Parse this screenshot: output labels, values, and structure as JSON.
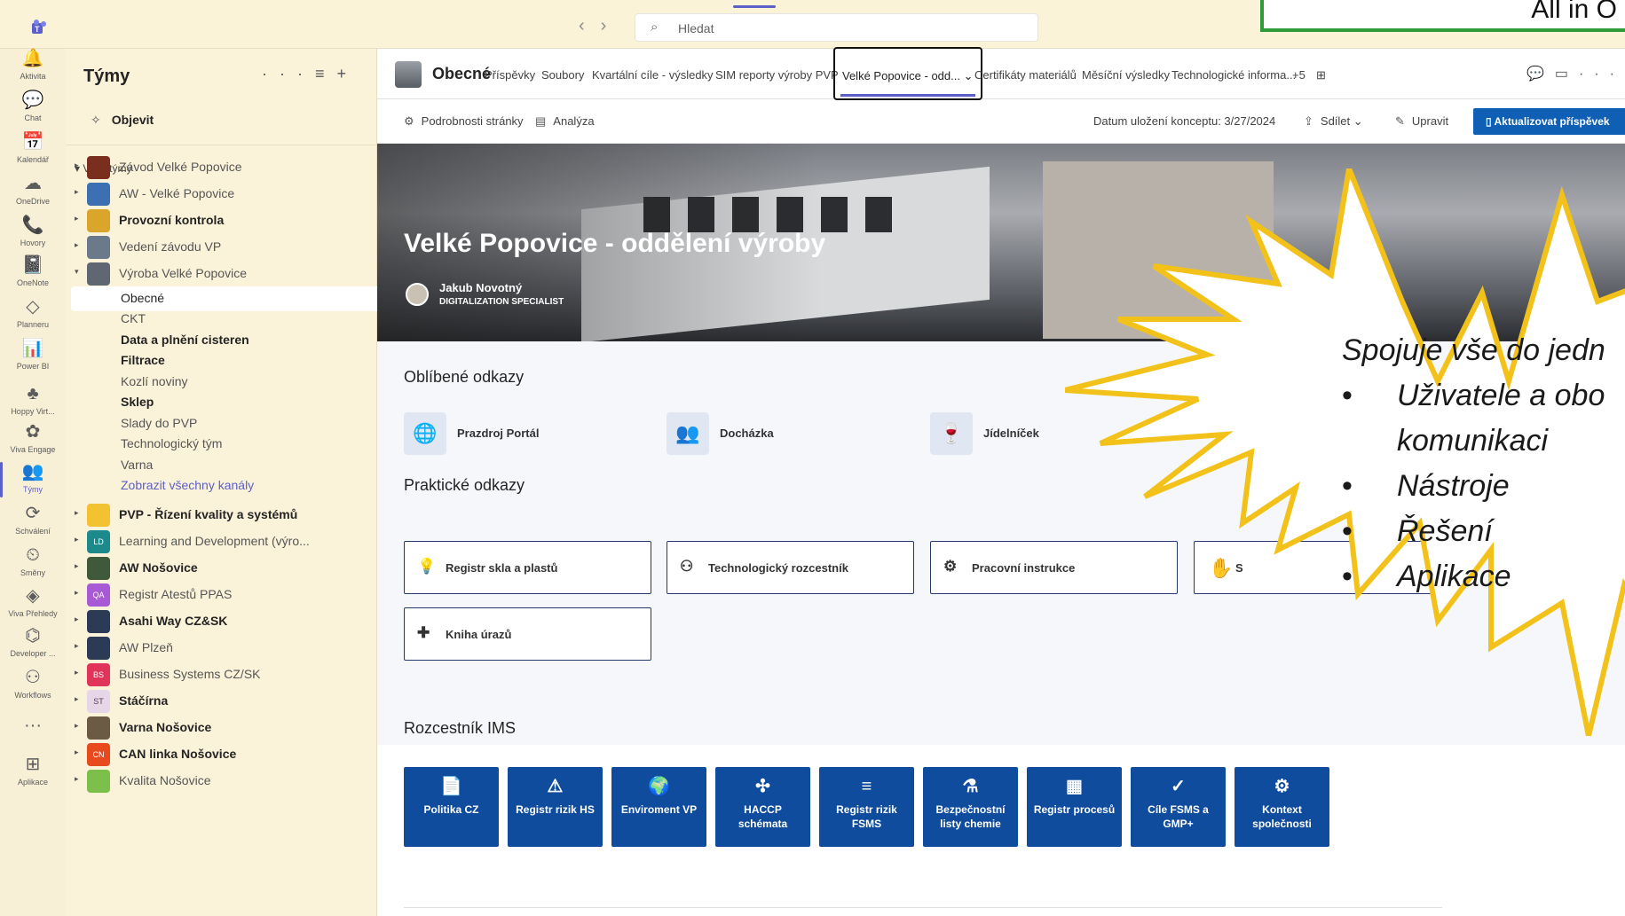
{
  "top": {
    "search_placeholder": "Hledat",
    "overlay_text": "All in O"
  },
  "rail": [
    {
      "icon": "bell-icon",
      "glyph": "🔔",
      "label": "Aktivita"
    },
    {
      "icon": "chat-icon",
      "glyph": "💬",
      "label": "Chat"
    },
    {
      "icon": "calendar-icon",
      "glyph": "📅",
      "label": "Kalendář"
    },
    {
      "icon": "cloud-icon",
      "glyph": "☁",
      "label": "OneDrive"
    },
    {
      "icon": "phone-icon",
      "glyph": "📞",
      "label": "Hovory"
    },
    {
      "icon": "onenote-icon",
      "glyph": "📓",
      "label": "OneNote"
    },
    {
      "icon": "planner-icon",
      "glyph": "◇",
      "label": "Planneru"
    },
    {
      "icon": "powerbi-icon",
      "glyph": "📊",
      "label": "Power BI"
    },
    {
      "icon": "hoppy-icon",
      "glyph": "♣",
      "label": "Hoppy Virt..."
    },
    {
      "icon": "viva-engage-icon",
      "glyph": "✿",
      "label": "Viva Engage"
    },
    {
      "icon": "teams-icon",
      "glyph": "👥",
      "label": "Týmy"
    },
    {
      "icon": "approvals-icon",
      "glyph": "⟳",
      "label": "Schválení"
    },
    {
      "icon": "shifts-icon",
      "glyph": "⏲",
      "label": "Směny"
    },
    {
      "icon": "viva-insights-icon",
      "glyph": "◈",
      "label": "Viva Přehledy"
    },
    {
      "icon": "developer-icon",
      "glyph": "⌬",
      "label": "Developer ..."
    },
    {
      "icon": "workflows-icon",
      "glyph": "⚇",
      "label": "Workflows"
    },
    {
      "icon": "more-icon",
      "glyph": "···",
      "label": ""
    },
    {
      "icon": "apps-icon",
      "glyph": "⊞",
      "label": "Aplikace"
    }
  ],
  "teamlist": {
    "title": "Týmy",
    "discover": "Objevit",
    "your_teams": "Vaše týmy",
    "teams_top": [
      {
        "name": "Závod Velké Popovice",
        "color": "#7a2e1e",
        "abbr": "",
        "bold": false
      },
      {
        "name": "AW - Velké Popovice",
        "color": "#3d6fb3",
        "abbr": "",
        "bold": false
      },
      {
        "name": "Provozní kontrola",
        "color": "#d9a52a",
        "abbr": "",
        "bold": true
      },
      {
        "name": "Vedení závodu VP",
        "color": "#6b7a8a",
        "abbr": "",
        "bold": false
      },
      {
        "name": "Výroba Velké Popovice",
        "color": "#5f6872",
        "abbr": "",
        "bold": false
      }
    ],
    "channels": [
      {
        "name": "Obecné",
        "style": "sel"
      },
      {
        "name": "CKT",
        "style": "dim"
      },
      {
        "name": "Data a plnění cisteren",
        "style": "bold"
      },
      {
        "name": "Filtrace",
        "style": "bold"
      },
      {
        "name": "Kozlí noviny",
        "style": "dim"
      },
      {
        "name": "Sklep",
        "style": "bold"
      },
      {
        "name": "Slady do PVP",
        "style": "dim"
      },
      {
        "name": "Technologický tým",
        "style": "dim"
      },
      {
        "name": "Varna",
        "style": "dim"
      },
      {
        "name": "Zobrazit všechny kanály",
        "style": "link"
      }
    ],
    "teams_bottom": [
      {
        "name": "PVP - Řízení kvality a systémů",
        "color": "#f2c230",
        "abbr": "",
        "bold": true
      },
      {
        "name": "Learning and Development (výro...",
        "color": "#1c8a8a",
        "abbr": "LD",
        "bold": false
      },
      {
        "name": "AW Nošovice",
        "color": "#3f5a3a",
        "abbr": "",
        "bold": true
      },
      {
        "name": "Registr Atestů PPAS",
        "color": "#a85ad6",
        "abbr": "QA",
        "bold": false
      },
      {
        "name": "Asahi Way CZ&SK",
        "color": "#2b3a55",
        "abbr": "",
        "bold": true
      },
      {
        "name": "AW Plzeň",
        "color": "#2b3a55",
        "abbr": "",
        "bold": false
      },
      {
        "name": "Business Systems CZ/SK",
        "color": "#e0345a",
        "abbr": "BS",
        "bold": false
      },
      {
        "name": "Stáčírna",
        "color": "#e7d6e8",
        "abbr": "ST",
        "bold": true
      },
      {
        "name": "Varna Nošovice",
        "color": "#6b5a44",
        "abbr": "",
        "bold": true
      },
      {
        "name": "CAN linka Nošovice",
        "color": "#e84a1e",
        "abbr": "CN",
        "bold": true
      },
      {
        "name": "Kvalita Nošovice",
        "color": "#7cbf4a",
        "abbr": "",
        "bold": false
      }
    ]
  },
  "tabbar": {
    "channel": "Obecné",
    "tabs": [
      "Příspěvky",
      "Soubory",
      "Kvartální cíle - výsledky",
      "SIM reporty výroby PVP",
      "Velké Popovice - odd...",
      "Certifikáty materiálů",
      "Měsíční výsledky",
      "Technologické informa...",
      "+5"
    ]
  },
  "cmdbar": {
    "details": "Podrobnosti stránky",
    "analytics": "Analýza",
    "draft_saved": "Datum uložení konceptu: 3/27/2024",
    "share": "Sdílet",
    "edit": "Upravit",
    "update": "Aktualizovat příspěvek"
  },
  "hero": {
    "title": "Velké Popovice - oddělení výroby",
    "author": "Jakub Novotný",
    "role": "DIGITALIZATION SPECIALIST"
  },
  "favorites": {
    "title": "Oblíbené odkazy",
    "items": [
      {
        "label": "Prazdroj Portál",
        "glyph": "🌐",
        "icon": "globe-icon"
      },
      {
        "label": "Docházka",
        "glyph": "👥",
        "icon": "people-icon"
      },
      {
        "label": "Jídelníček",
        "glyph": "🍷",
        "icon": "glass-icon"
      }
    ]
  },
  "practical": {
    "title": "Praktické odkazy",
    "items": [
      {
        "label": "Registr skla a plastů",
        "glyph": "💡",
        "icon": "lightbulb-icon"
      },
      {
        "label": "Technologický rozcestník",
        "glyph": "⚇",
        "icon": "people-search-icon"
      },
      {
        "label": "Pracovní instrukce",
        "glyph": "⚙",
        "icon": "gear-icon"
      },
      {
        "label": "S",
        "glyph": "",
        "icon": ""
      },
      {
        "label": "Kniha úrazů",
        "glyph": "✚",
        "icon": "bandage-icon"
      }
    ]
  },
  "ims": {
    "title": "Rozcestník IMS",
    "items": [
      {
        "label": "Politika CZ",
        "glyph": "📄",
        "icon": "document-icon"
      },
      {
        "label": "Registr rizik HS",
        "glyph": "⚠",
        "icon": "person-warning-icon"
      },
      {
        "label": "Enviroment VP",
        "glyph": "🌍",
        "icon": "earth-icon"
      },
      {
        "label": "HACCP schémata",
        "glyph": "✣",
        "icon": "flow-icon"
      },
      {
        "label": "Registr rizik FSMS",
        "glyph": "≡",
        "icon": "list-icon"
      },
      {
        "label": "Bezpečnostní listy chemie",
        "glyph": "⚗",
        "icon": "flask-icon"
      },
      {
        "label": "Registr procesů",
        "glyph": "▦",
        "icon": "building-icon"
      },
      {
        "label": "Cíle FSMS a GMP+",
        "glyph": "✓",
        "icon": "check-circle-icon"
      },
      {
        "label": "Kontext společnosti",
        "glyph": "⚙",
        "icon": "org-icon"
      }
    ]
  },
  "callout": {
    "headline": "Spojuje vše do jedn",
    "bullets": [
      "Uživatele a obo",
      "Nástroje",
      "Řešení",
      "Aplikace"
    ],
    "bullet1_cont": "komunikaci"
  },
  "colors": {
    "accent": "#5b5fc7",
    "primary_button": "#0f5fb5",
    "ims_tile": "#0f4c9e",
    "burst_stroke": "#f2c21a",
    "overlay_border": "#2e9a3a"
  }
}
